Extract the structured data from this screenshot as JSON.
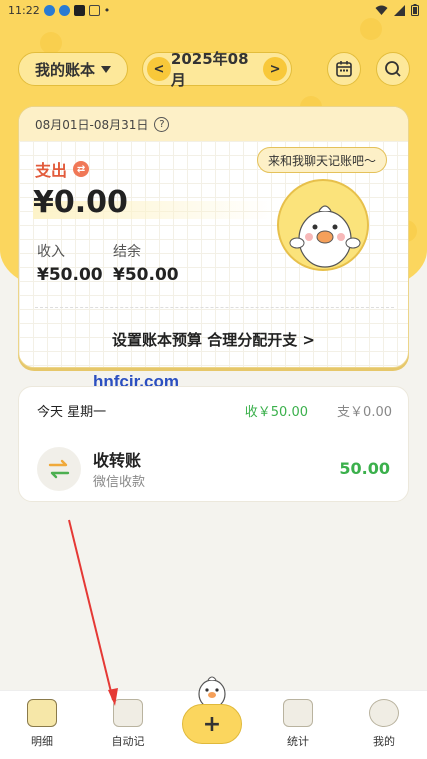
{
  "status_bar": {
    "time": "11:22",
    "dot": "•"
  },
  "header": {
    "book_label": "我的账本",
    "month_label": "2025年08月",
    "prev": "<",
    "next": ">"
  },
  "summary": {
    "date_range": "08月01日-08月31日",
    "help": "?",
    "expense_label": "支出",
    "expense_amount": "¥0.00",
    "income_label": "收入",
    "income_amount": "¥50.00",
    "balance_label": "结余",
    "balance_amount": "¥50.00",
    "budget_link": "设置账本预算 合理分配开支 >",
    "chat_bubble": "来和我聊天记账吧～"
  },
  "watermark": "hnfcjr.com",
  "day": {
    "date": "今天 星期一",
    "income": "收￥50.00",
    "expense": "支￥0.00",
    "transaction": {
      "title": "收转账",
      "subtitle": "微信收款",
      "amount": "50.00"
    }
  },
  "tabbar": {
    "tabs": [
      {
        "label": "明细",
        "icon": "ledger-icon"
      },
      {
        "label": "自动记",
        "icon": "notebook-icon"
      },
      {
        "label": "统计",
        "icon": "calendar-chart-icon"
      },
      {
        "label": "我的",
        "icon": "duck-profile-icon"
      }
    ],
    "add": "+"
  },
  "colors": {
    "brand_yellow": "#fbd65e",
    "expense_red": "#e25b3b",
    "income_green": "#3bb04c",
    "annotation_arrow": "#e53935"
  }
}
